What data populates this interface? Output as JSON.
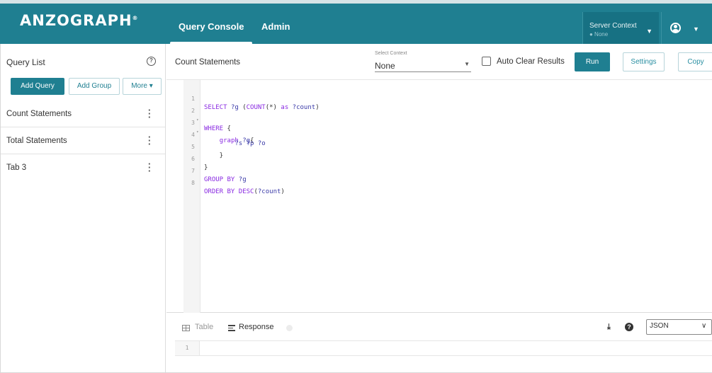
{
  "header": {
    "logo": "ANZOGRAPH",
    "logo_mark": "®",
    "tabs": [
      {
        "label": "Query Console"
      },
      {
        "label": "Admin"
      }
    ],
    "server_context": {
      "title": "Server Context",
      "status": "● None"
    },
    "user_icon": "user-circle-icon",
    "accent_color": "#1f7f91"
  },
  "sidebar": {
    "title": "Query List",
    "buttons": {
      "add_query": "Add Query",
      "add_group": "Add Group",
      "more": "More ▾"
    },
    "items": [
      {
        "label": "Count Statements"
      },
      {
        "label": "Total Statements"
      },
      {
        "label": "Tab 3"
      }
    ]
  },
  "main": {
    "title": "Count Statements",
    "context": {
      "label": "Select Context",
      "value": "None"
    },
    "auto_clear_label": "Auto Clear Results",
    "auto_clear_checked": false,
    "run_label": "Run",
    "settings_label": "Settings",
    "copy_label": "Copy"
  },
  "editor": {
    "line_numbers": [
      "1",
      "2",
      "3",
      "4",
      "5",
      "6",
      "7",
      "8"
    ],
    "folds": [
      "",
      "▾",
      "▾",
      "",
      "",
      "",
      "",
      ""
    ]
  },
  "results": {
    "tabs": [
      {
        "label": "Table"
      },
      {
        "label": "Response"
      }
    ],
    "format": "JSON",
    "line_number": "1"
  }
}
